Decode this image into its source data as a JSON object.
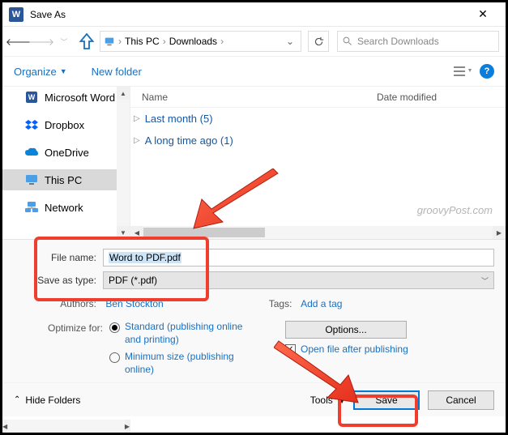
{
  "title": "Save As",
  "breadcrumb": {
    "root": "This PC",
    "folder": "Downloads"
  },
  "search": {
    "placeholder": "Search Downloads"
  },
  "toolbar": {
    "organize": "Organize",
    "newfolder": "New folder"
  },
  "sidebar": {
    "items": [
      {
        "label": "Microsoft Word",
        "icon": "word"
      },
      {
        "label": "Dropbox",
        "icon": "dropbox"
      },
      {
        "label": "OneDrive",
        "icon": "onedrive"
      },
      {
        "label": "This PC",
        "icon": "pc",
        "selected": true
      },
      {
        "label": "Network",
        "icon": "network"
      }
    ]
  },
  "columns": {
    "name": "Name",
    "date": "Date modified"
  },
  "groups": [
    {
      "label": "Last month (5)"
    },
    {
      "label": "A long time ago (1)"
    }
  ],
  "watermark": "groovyPost.com",
  "fields": {
    "filename_label": "File name:",
    "filename_value": "Word to PDF.pdf",
    "type_label": "Save as type:",
    "type_value": "PDF (*.pdf)",
    "authors_label": "Authors:",
    "authors_value": "Ben Stockton",
    "tags_label": "Tags:",
    "tags_value": "Add a tag"
  },
  "optimize": {
    "label": "Optimize for:",
    "standard": "Standard (publishing online and printing)",
    "minimum": "Minimum size (publishing online)"
  },
  "options_btn": "Options...",
  "open_after": "Open file after publishing",
  "footer": {
    "hide": "Hide Folders",
    "tools": "Tools",
    "save": "Save",
    "cancel": "Cancel"
  }
}
